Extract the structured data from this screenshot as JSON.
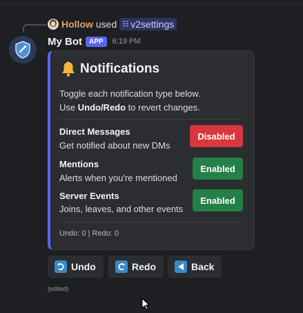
{
  "command": {
    "user": "Hollow",
    "used_text": "used",
    "name": "v2settings",
    "slash_icon": "slash-command-icon"
  },
  "message": {
    "author": "My Bot",
    "badge": "APP",
    "timestamp": "6:19 PM",
    "edited": "(edited)"
  },
  "embed": {
    "accent_color": "#5865f2",
    "title_icon": "bell-icon",
    "title": "Notifications",
    "desc_line1": "Toggle each notification type below.",
    "desc_use": "Use ",
    "desc_bold": "Undo/Redo",
    "desc_rest": " to revert changes.",
    "items": [
      {
        "title": "Direct Messages",
        "subtitle": "Get notified about new DMs",
        "button": "Disabled",
        "state_color": "#da373c"
      },
      {
        "title": "Mentions",
        "subtitle": "Alerts when you're mentioned",
        "button": "Enabled",
        "state_color": "#248046"
      },
      {
        "title": "Server Events",
        "subtitle": "Joins, leaves, and other events",
        "button": "Enabled",
        "state_color": "#248046"
      }
    ],
    "footer": "Undo: 0 | Redo: 0"
  },
  "actions": {
    "undo": "Undo",
    "redo": "Redo",
    "back": "Back"
  }
}
